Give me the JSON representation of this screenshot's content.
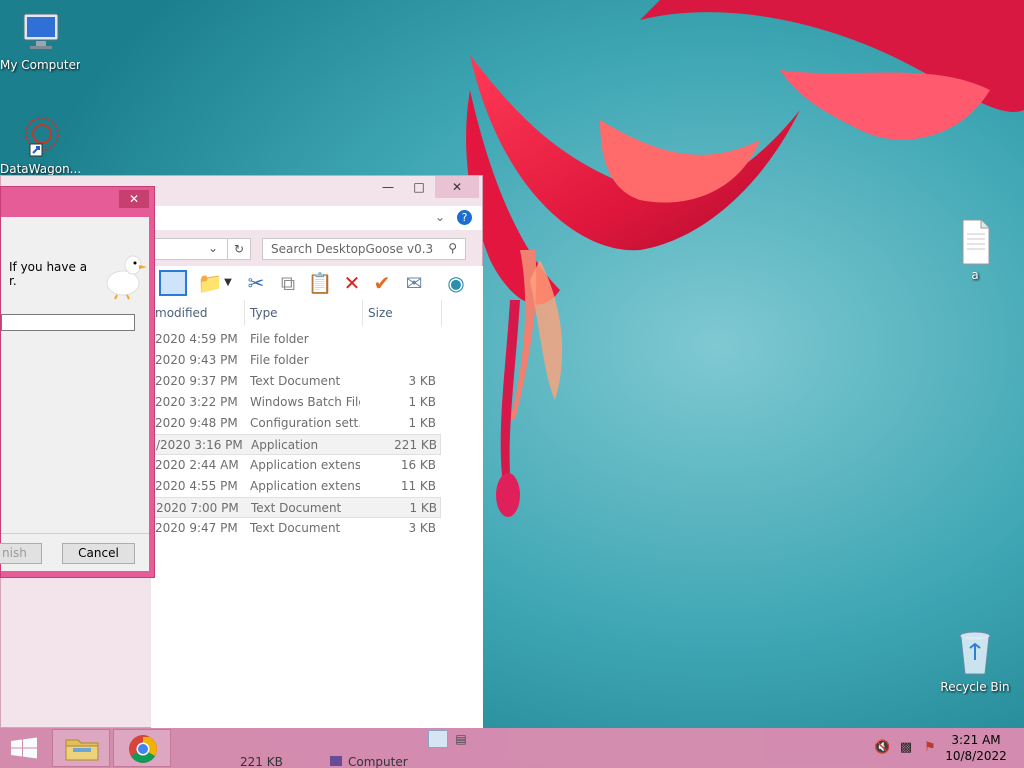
{
  "desktop": {
    "icons": [
      {
        "label": "My Computer"
      },
      {
        "label": "DataWagon..."
      },
      {
        "label": "a"
      },
      {
        "label": "Recycle Bin"
      }
    ]
  },
  "explorer": {
    "search_placeholder": "Search DesktopGoose v0.3",
    "columns": {
      "modified": "modified",
      "type": "Type",
      "size": "Size"
    },
    "rows": [
      {
        "modified": "2020 4:59 PM",
        "type": "File folder",
        "size": ""
      },
      {
        "modified": "2020 9:43 PM",
        "type": "File folder",
        "size": ""
      },
      {
        "modified": "2020 9:37 PM",
        "type": "Text Document",
        "size": "3 KB"
      },
      {
        "modified": "2020 3:22 PM",
        "type": "Windows Batch File",
        "size": "1 KB"
      },
      {
        "modified": "2020 9:48 PM",
        "type": "Configuration sett...",
        "size": "1 KB"
      },
      {
        "modified": "/2020 3:16 PM",
        "type": "Application",
        "size": "221 KB"
      },
      {
        "modified": "2020 2:44 AM",
        "type": "Application extens...",
        "size": "16 KB"
      },
      {
        "modified": "2020 4:55 PM",
        "type": "Application extens...",
        "size": "11 KB"
      },
      {
        "modified": "2020 7:00 PM",
        "type": "Text Document",
        "size": "1 KB"
      },
      {
        "modified": "2020 9:47 PM",
        "type": "Text Document",
        "size": "3 KB"
      }
    ],
    "status_size": "221 KB",
    "status_location": "Computer"
  },
  "dialog": {
    "message": "If you have a r.",
    "finish_label": "nish",
    "cancel_label": "Cancel"
  },
  "taskbar": {
    "time": "3:21 AM",
    "date": "10/8/2022"
  },
  "colors": {
    "accent": "#e65c96",
    "taskbar": "#d98cb0",
    "window_frame": "#f3e3ea"
  }
}
